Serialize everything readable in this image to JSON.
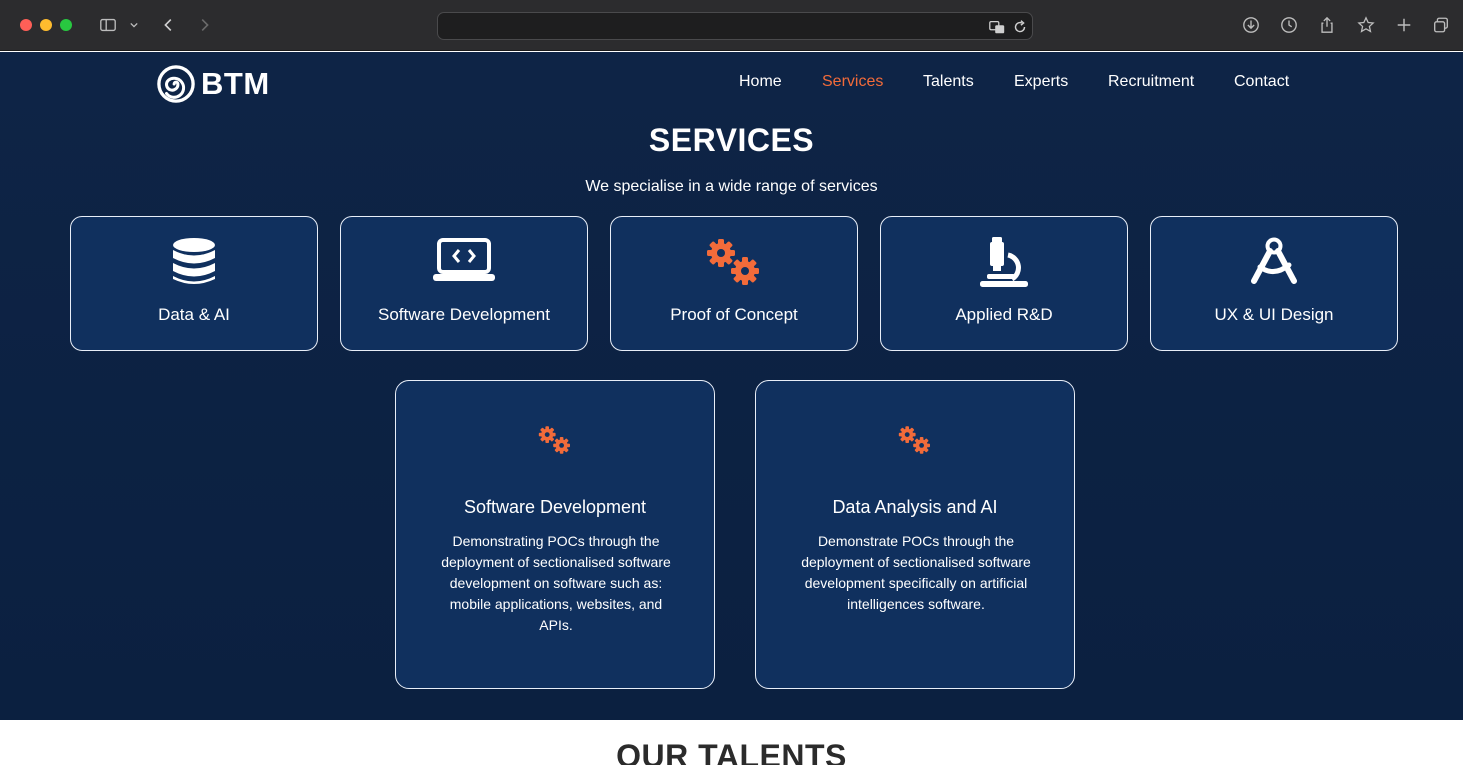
{
  "browser": {
    "url": "",
    "colors": {
      "close": "#fe5f57",
      "minimize": "#febc2e",
      "maximize": "#28c840"
    }
  },
  "site": {
    "logo_text": "BTM",
    "nav": [
      {
        "label": "Home",
        "active": false
      },
      {
        "label": "Services",
        "active": true
      },
      {
        "label": "Talents",
        "active": false
      },
      {
        "label": "Experts",
        "active": false
      },
      {
        "label": "Recruitment",
        "active": false
      },
      {
        "label": "Contact",
        "active": false
      }
    ],
    "accent_color": "#f26b3a",
    "background_color": "#0e2446"
  },
  "services": {
    "title": "SERVICES",
    "subtitle": "We specialise in a wide range of services",
    "items": [
      {
        "label": "Data & AI",
        "icon": "database-icon"
      },
      {
        "label": "Software Development",
        "icon": "laptop-code-icon"
      },
      {
        "label": "Proof of Concept",
        "icon": "gears-icon"
      },
      {
        "label": "Applied R&D",
        "icon": "microscope-icon"
      },
      {
        "label": "UX & UI Design",
        "icon": "compass-drafting-icon"
      }
    ]
  },
  "poc_cards": [
    {
      "title": "Software Development",
      "description": "Demonstrating POCs through the deployment of sectionalised software development on software such as: mobile applications, websites, and APIs."
    },
    {
      "title": "Data Analysis and AI",
      "description": "Demonstrate POCs through the deployment of sectionalised software development specifically on artificial intelligences software."
    }
  ],
  "next_section": {
    "title": "OUR TALENTS"
  }
}
